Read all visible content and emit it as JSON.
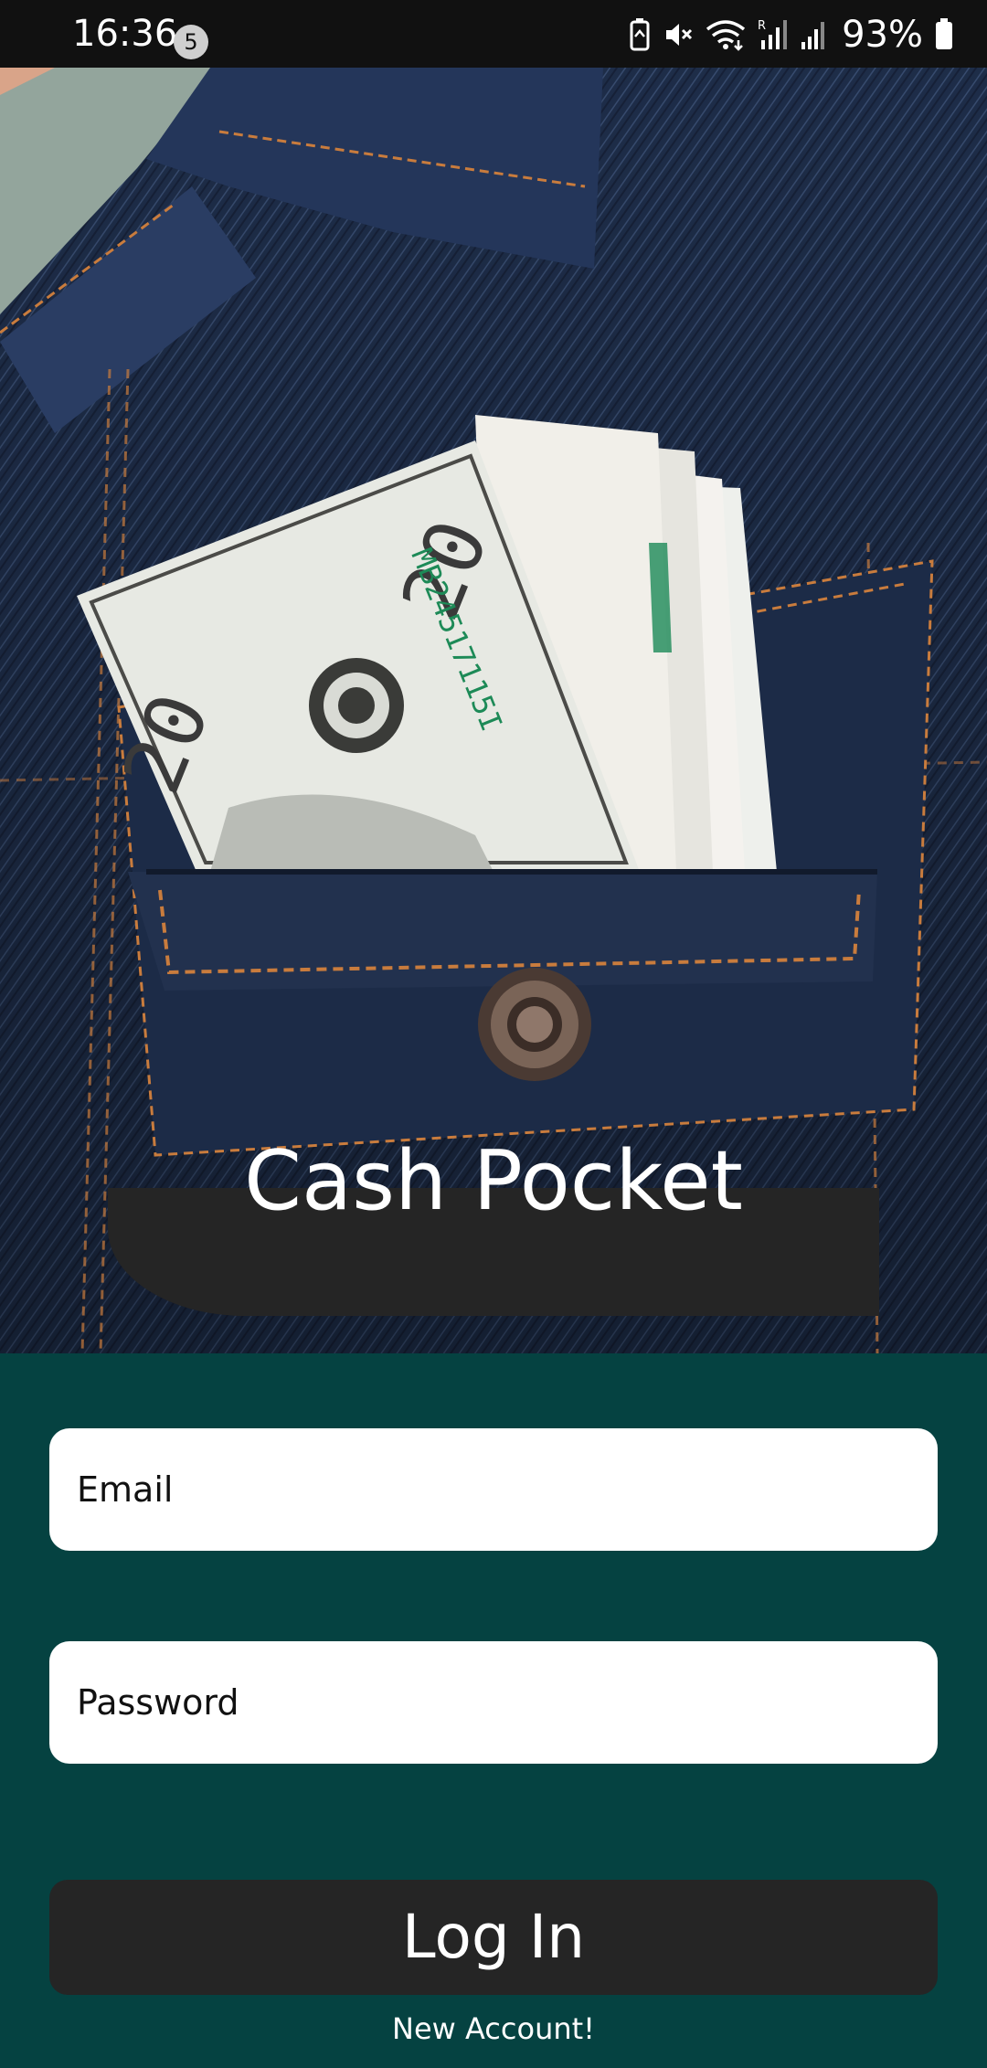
{
  "status_bar": {
    "time": "16:36",
    "notification_count": "5",
    "battery_percent": "93%",
    "icons": [
      "battery-saver-icon",
      "mute-icon",
      "wifi-icon",
      "signal-roaming-icon",
      "signal-icon",
      "battery-icon"
    ]
  },
  "hero": {
    "image": "denim-jacket-pocket-with-dollar-bills",
    "title": "Cash Pocket"
  },
  "form": {
    "email_placeholder": "Email",
    "password_placeholder": "Password",
    "login_label": "Log In",
    "new_account_label": "New Account!"
  },
  "colors": {
    "background": "#054241",
    "banner": "#252525",
    "field": "#ffffff",
    "button": "#252525"
  }
}
